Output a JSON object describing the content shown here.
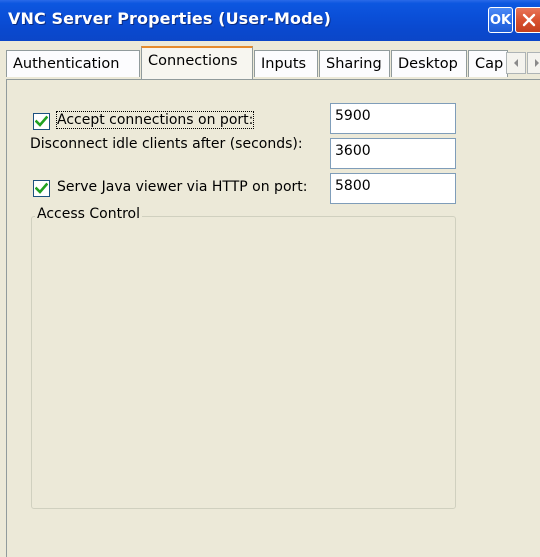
{
  "window": {
    "title": "VNC Server Properties (User-Mode)",
    "ok_label": "OK"
  },
  "tabs": [
    {
      "label": "Authentication"
    },
    {
      "label": "Connections"
    },
    {
      "label": "Inputs"
    },
    {
      "label": "Sharing"
    },
    {
      "label": "Desktop"
    },
    {
      "label": "Cap"
    }
  ],
  "connections": {
    "accept_label": "Accept connections on port:",
    "accept_checked": true,
    "accept_port": "5900",
    "idle_label": "Disconnect idle clients after (seconds):",
    "idle_value": "3600",
    "java_label": "Serve Java viewer via HTTP on port:",
    "java_checked": true,
    "java_port": "5800",
    "access_control_title": "Access Control"
  },
  "colors": {
    "titlebar": "#0a4fd8",
    "tab_highlight": "#e68b2c",
    "checkmark": "#21a121",
    "close_button": "#d9512f"
  }
}
